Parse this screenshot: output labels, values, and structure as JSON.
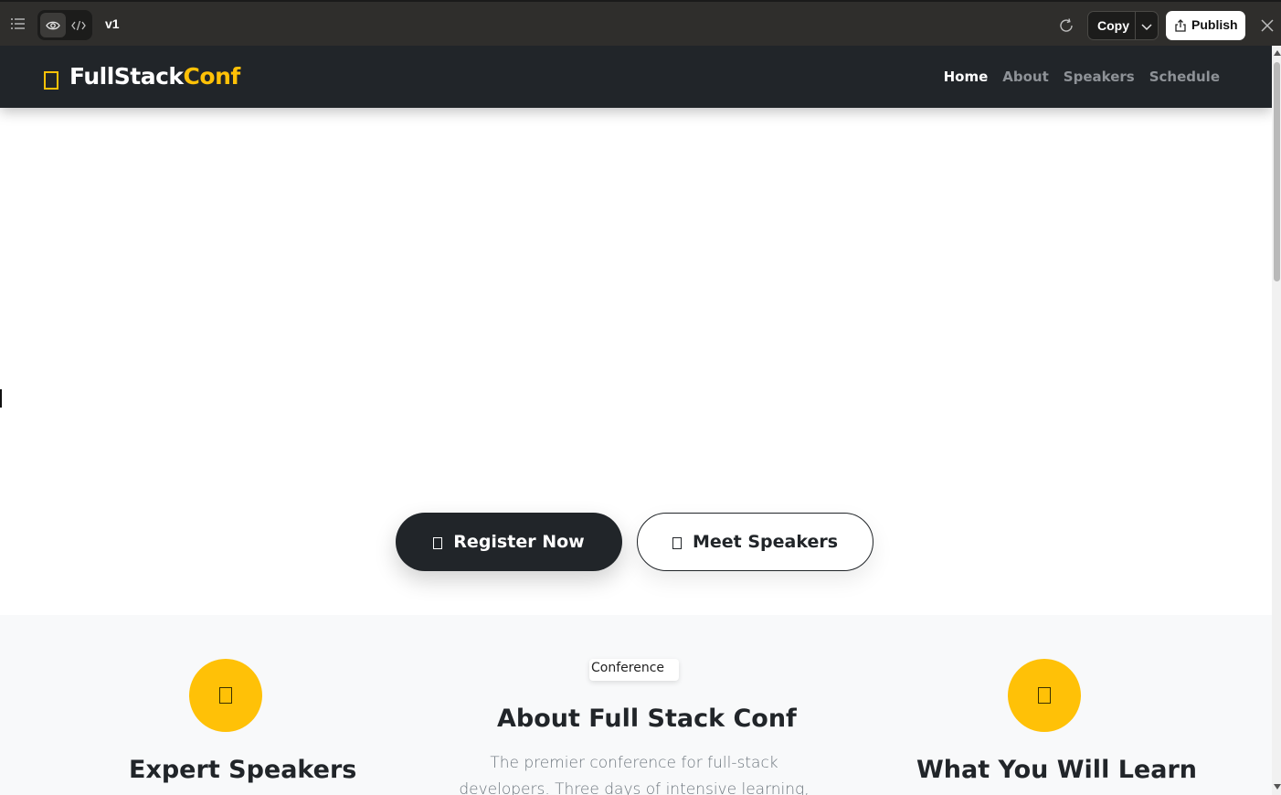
{
  "editor_toolbar": {
    "menu_icon": "list-icon",
    "preview_icon": "eye-icon",
    "code_icon": "code-icon",
    "version": "v1",
    "refresh_icon": "refresh-icon",
    "copy_label": "Copy",
    "copy_menu_icon": "chevron-down-icon",
    "publish_label": "Publish",
    "publish_icon": "share-icon",
    "close_icon": "close-icon"
  },
  "site": {
    "brand": {
      "part1": "FullStack",
      "part2": "Conf",
      "accent": "#ffc107"
    },
    "nav": [
      {
        "label": "Home",
        "active": true
      },
      {
        "label": "About",
        "active": false
      },
      {
        "label": "Speakers",
        "active": false
      },
      {
        "label": "Schedule",
        "active": false
      }
    ],
    "hero": {
      "primary_button": "Register Now",
      "secondary_button": "Meet Speakers"
    },
    "features": {
      "left_title": "Expert Speakers",
      "center_image_alt": "Conference",
      "center_title": "About Full Stack Conf",
      "center_text": "The premier conference for full-stack developers. Three days of intensive learning,",
      "right_title": "What You Will Learn"
    }
  },
  "colors": {
    "toolbar_bg": "#2f2e2c",
    "nav_bg": "#212529",
    "accent": "#ffc107",
    "features_bg": "#f8f9fa"
  }
}
